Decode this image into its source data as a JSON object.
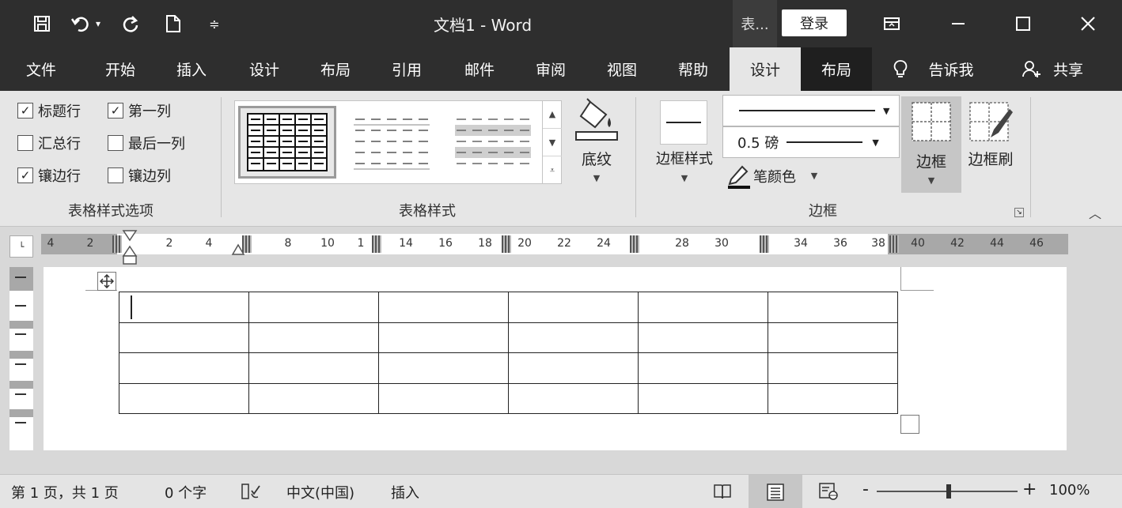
{
  "titlebar": {
    "doc_title": "文档1  -  Word",
    "context_tools_label": "表...",
    "login_label": "登录"
  },
  "tabs": [
    {
      "label": "文件"
    },
    {
      "label": "开始"
    },
    {
      "label": "插入"
    },
    {
      "label": "设计"
    },
    {
      "label": "布局"
    },
    {
      "label": "引用"
    },
    {
      "label": "邮件"
    },
    {
      "label": "审阅"
    },
    {
      "label": "视图"
    },
    {
      "label": "帮助"
    },
    {
      "label": "设计",
      "active": true,
      "contextual": true
    },
    {
      "label": "布局",
      "contextual": true
    }
  ],
  "tell_me": {
    "label": "告诉我",
    "icon": "lightbulb-icon"
  },
  "share": {
    "label": "共享",
    "icon": "person-add-icon"
  },
  "ribbon": {
    "style_options": {
      "group_label": "表格样式选项",
      "checkboxes": [
        {
          "label": "标题行",
          "checked": true
        },
        {
          "label": "第一列",
          "checked": true
        },
        {
          "label": "汇总行",
          "checked": false
        },
        {
          "label": "最后一列",
          "checked": false
        },
        {
          "label": "镶边行",
          "checked": true
        },
        {
          "label": "镶边列",
          "checked": false
        }
      ]
    },
    "table_styles": {
      "group_label": "表格样式",
      "shading_label": "底纹"
    },
    "borders": {
      "group_label": "边框",
      "border_style_label": "边框样式",
      "line_weight": "0.5 磅",
      "pen_color_label": "笔颜色",
      "borders_label": "边框",
      "border_painter_label": "边框刷"
    }
  },
  "ruler": {
    "ticks": [
      "4",
      "2",
      "2",
      "4",
      "8",
      "10",
      "1",
      "14",
      "16",
      "18",
      "20",
      "22",
      "24",
      "28",
      "30",
      "34",
      "36",
      "38",
      "40",
      "42",
      "44",
      "46"
    ]
  },
  "document": {
    "table": {
      "rows": 4,
      "cols": 6
    }
  },
  "statusbar": {
    "page_info": "第 1 页，共 1 页",
    "word_count": "0 个字",
    "language": "中文(中国)",
    "mode": "插入",
    "zoom": "100%",
    "zoom_level": 1.0
  }
}
